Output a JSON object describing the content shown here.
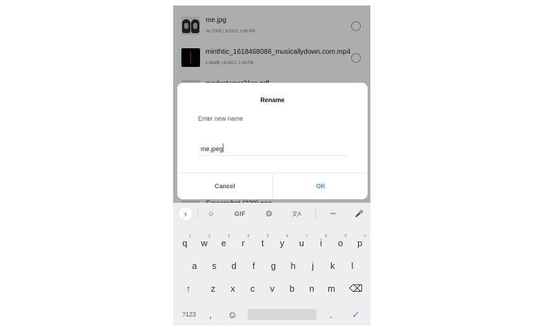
{
  "files": [
    {
      "name": "me.jpg",
      "size": "34.72KB",
      "date": "3/23/21 3:49 PM",
      "thumb": "photo-thumbnail"
    },
    {
      "name": "minthtic_1618468086_musicallydown.com.mp4",
      "size": "1.98MB",
      "date": "4/15/21 1:28 PM",
      "thumb": "video-thumbnail"
    },
    {
      "name": "modestwear21ss.pdf",
      "size": "",
      "date": "",
      "thumb": "document-thumbnail"
    },
    {
      "name": "Screenshot (220).png",
      "size": "",
      "date": "",
      "thumb": "image-thumbnail"
    }
  ],
  "meta_separator": "|",
  "dialog": {
    "title": "Rename",
    "prompt": "Enter new name",
    "value": "me.jpeg",
    "cancel_label": "Cancel",
    "ok_label": "OK"
  },
  "keyboard": {
    "toolbar": {
      "back_icon": "‹",
      "sticker_icon": "☺",
      "gif_label": "GIF",
      "settings_icon": "⚙",
      "translate_icon": "文A",
      "more_icon": "•••",
      "mic_icon": "🎤"
    },
    "row1": [
      {
        "key": "q",
        "hint": "1"
      },
      {
        "key": "w",
        "hint": "2"
      },
      {
        "key": "e",
        "hint": "3"
      },
      {
        "key": "r",
        "hint": "4"
      },
      {
        "key": "t",
        "hint": "5"
      },
      {
        "key": "y",
        "hint": "6"
      },
      {
        "key": "u",
        "hint": "7"
      },
      {
        "key": "i",
        "hint": "8"
      },
      {
        "key": "o",
        "hint": "9"
      },
      {
        "key": "p",
        "hint": "0"
      }
    ],
    "row2": [
      "a",
      "s",
      "d",
      "f",
      "g",
      "h",
      "j",
      "k",
      "l"
    ],
    "row3": [
      "z",
      "x",
      "c",
      "v",
      "b",
      "n",
      "m"
    ],
    "shift_icon": "↑",
    "backspace_icon": "⌫",
    "num_label": "?123",
    "comma_label": ",",
    "emoji_icon": "☺",
    "period_label": ".",
    "enter_icon": "✓"
  },
  "colors": {
    "accent": "#3a8fd9",
    "dialog_bg": "#ffffff",
    "keyboard_bg": "#eeeeee"
  }
}
